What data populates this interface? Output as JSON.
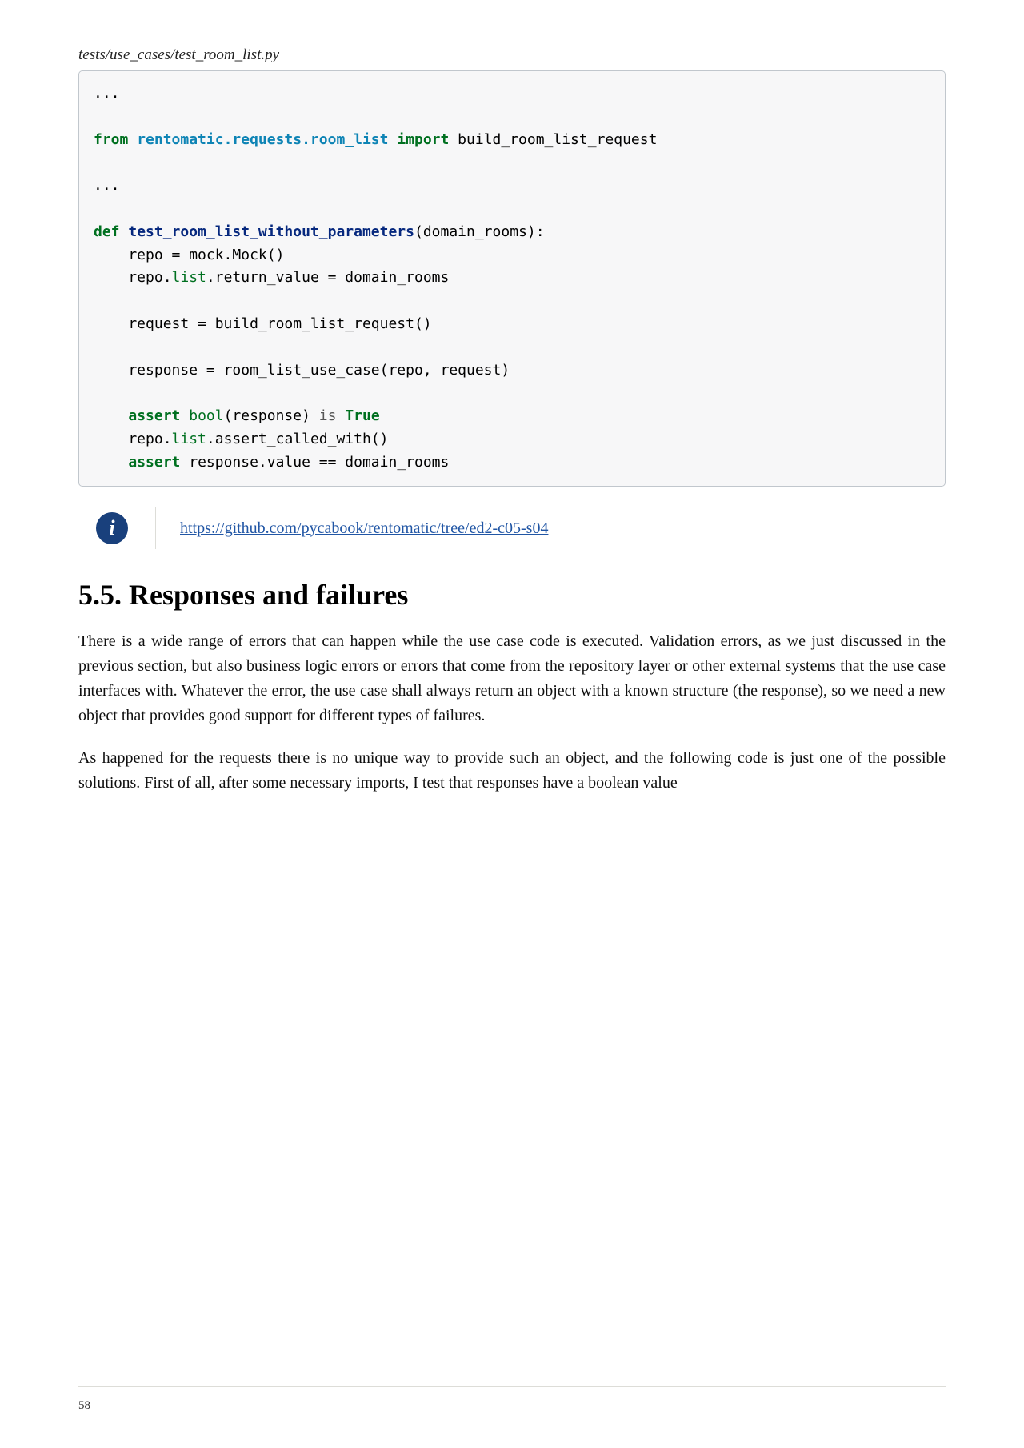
{
  "file_path": "tests/use_cases/test_room_list.py",
  "code": {
    "l1": "...",
    "l2_from": "from",
    "l2_mod": " rentomatic.requests.room_list ",
    "l2_imp": "import",
    "l2_name": " build_room_list_request",
    "l3": "...",
    "l4_def": "def",
    "l4_fn": " test_room_list_without_parameters",
    "l4_rest": "(domain_rooms):",
    "l5": "    repo = mock.Mock()",
    "l6a": "    repo.",
    "l6b": "list",
    "l6c": ".return_value = domain_rooms",
    "l7": "    request = build_room_list_request()",
    "l8": "    response = room_list_use_case(repo, request)",
    "l9a": "    ",
    "l9_assert": "assert",
    "l9_bool": " bool",
    "l9b": "(response) ",
    "l9_is": "is",
    "l9_true": " True",
    "l10a": "    repo.",
    "l10b": "list",
    "l10c": ".assert_called_with()",
    "l11a": "    ",
    "l11_assert": "assert",
    "l11b": " response.value == domain_rooms"
  },
  "link": "https://github.com/pycabook/rentomatic/tree/ed2-c05-s04",
  "heading": "5.5. Responses and failures",
  "para1": "There is a wide range of errors that can happen while the use case code is executed. Validation errors, as we just discussed in the previous section, but also business logic errors or errors that come from the repository layer or other external systems that the use case interfaces with. Whatever the error, the use case shall always return an object with a known structure (the response), so we need a new object that provides good support for different types of failures.",
  "para2": "As happened for the requests there is no unique way to provide such an object, and the following code is just one of the possible solutions. First of all, after some necessary imports, I test that responses have a boolean value",
  "page": "58"
}
